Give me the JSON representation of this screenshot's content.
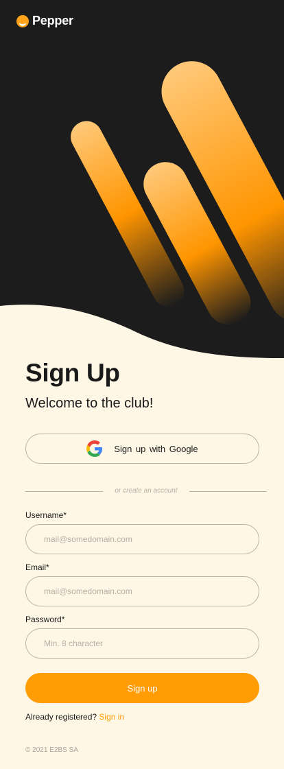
{
  "brand": {
    "name": "Pepper",
    "logo_icon": "pepper-logo-icon",
    "accent_color": "#ff9c06"
  },
  "hero": {
    "background_color": "#1c1c1c",
    "stripe_colors": [
      "#ffc97a",
      "#ff9500"
    ]
  },
  "signup": {
    "title": "Sign Up",
    "subtitle": "Welcome to the club!",
    "google_button": {
      "label": "Sign up  with Google",
      "icon": "google-icon"
    },
    "divider_text": "or create an account",
    "fields": {
      "username": {
        "label": "Username*",
        "placeholder": "mail@somedomain.com",
        "value": ""
      },
      "email": {
        "label": "Email*",
        "placeholder": "mail@somedomain.com",
        "value": ""
      },
      "password": {
        "label": "Password*",
        "placeholder": "Min. 8 character",
        "value": ""
      }
    },
    "submit_label": "Sign up",
    "already_registered_text": "Already registered?",
    "signin_link_label": "Sign in"
  },
  "footer": {
    "copyright": "© 2021 E2BS SA"
  }
}
